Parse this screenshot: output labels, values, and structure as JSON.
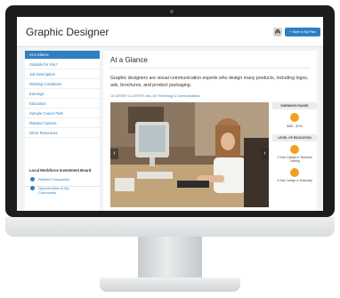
{
  "app": {
    "title": "Graphic Designer",
    "save_label": "Save to My Plan"
  },
  "sidebar": {
    "items": [
      {
        "label": "At a Glance",
        "active": true
      },
      {
        "label": "Suitable for You?"
      },
      {
        "label": "Job Description"
      },
      {
        "label": "Working Conditions"
      },
      {
        "label": "Earnings"
      },
      {
        "label": "Education"
      },
      {
        "label": "Sample Career Path"
      },
      {
        "label": "Related Careers"
      },
      {
        "label": "Other Resources"
      }
    ],
    "section_title": "Local Workforce Investment Board",
    "links": [
      {
        "label": "Related Companies"
      },
      {
        "label": "Opportunities in My Community"
      }
    ]
  },
  "content": {
    "title": "At a Glance",
    "description": "Graphic designers are visual communication experts who design many products, including logos, ads, brochures, and product packaging.",
    "clusters_label": "16 CAREER CLUSTERS:",
    "clusters_value": "Arts, A/V Technology & Communications"
  },
  "facts": {
    "earnings_label": "EARNINGS RANGE",
    "earnings_value": "$30K - $70K",
    "education_label": "LEVEL OF EDUCATION",
    "education_items": [
      "2-Year College or Technical Training",
      "4-Year College or University"
    ]
  },
  "colors": {
    "accent": "#2f7fc1",
    "highlight": "#f0a020"
  },
  "icons": {
    "print": "printer-icon",
    "save": "plus-icon",
    "carousel_prev": "chevron-left-icon",
    "carousel_next": "chevron-right-icon"
  }
}
